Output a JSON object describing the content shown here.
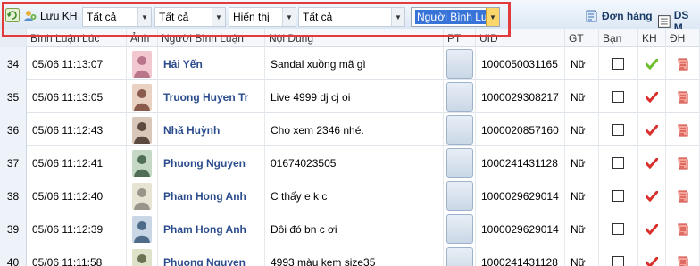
{
  "toolbar": {
    "save_label": "Lưu KH",
    "filters": [
      "Tất cả",
      "Tất cả",
      "Hiển thị",
      "Tất cả"
    ],
    "search_field_value": "Người Bình Lu",
    "orders_label": "Đơn hàng",
    "ds_label": "DS M"
  },
  "columns": {
    "time": "Bình Luận Lúc",
    "image": "Ảnh",
    "user": "Người Bình Luận",
    "content": "Nội Dung",
    "pt": "PT",
    "uid": "UID",
    "gender": "GT",
    "friend": "Bạn",
    "kh": "KH",
    "dh": "ĐH"
  },
  "rows": [
    {
      "idx": "34",
      "time": "05/06 11:13:07",
      "name": "Hải Yến",
      "content": "Sandal xuồng mã gì",
      "uid": "1000050031165",
      "gender": "Nữ",
      "kh": "green"
    },
    {
      "idx": "35",
      "time": "05/06 11:13:05",
      "name": "Truong Huyen Tr",
      "content": "Live 4999 dj cj oi",
      "uid": "1000029308217",
      "gender": "Nữ",
      "kh": "red"
    },
    {
      "idx": "36",
      "time": "05/06 11:12:43",
      "name": "Nhã Huỳnh",
      "content": "Cho xem 2346 nhé.",
      "uid": "1000020857160",
      "gender": "Nữ",
      "kh": "red"
    },
    {
      "idx": "37",
      "time": "05/06 11:12:41",
      "name": "Phuong Nguyen",
      "content": "01674023505",
      "uid": "1000241431128",
      "gender": "Nữ",
      "kh": "red"
    },
    {
      "idx": "38",
      "time": "05/06 11:12:40",
      "name": "Pham Hong Anh",
      "content": "C thấy e k c",
      "uid": "1000029629014",
      "gender": "Nữ",
      "kh": "red"
    },
    {
      "idx": "39",
      "time": "05/06 11:12:39",
      "name": "Pham Hong Anh",
      "content": "Đôi đó bn c ơi",
      "uid": "1000029629014",
      "gender": "Nữ",
      "kh": "red"
    },
    {
      "idx": "40",
      "time": "05/06 11:11:58",
      "name": "Phuong Nguyen",
      "content": "4993 màu kem size35",
      "uid": "1000241431128",
      "gender": "Nữ",
      "kh": "red"
    }
  ],
  "colors": {
    "highlight": "#e23b3b",
    "name_text": "#2b4c8c",
    "check_red": "#d9302c",
    "check_green": "#6cbf2a"
  }
}
